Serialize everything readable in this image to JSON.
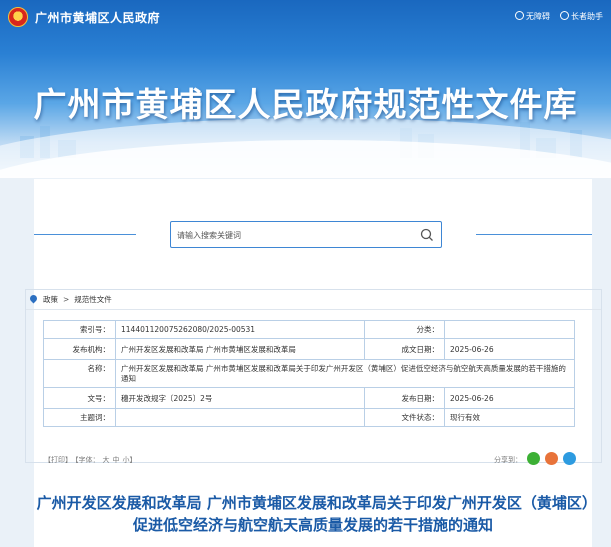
{
  "header": {
    "site_name": "广州市黄埔区人民政府",
    "links": [
      {
        "label": "无障碍",
        "icon": "accessibility-icon"
      },
      {
        "label": "长者助手",
        "icon": "elder-helper-icon"
      }
    ],
    "banner_title": "广州市黄埔区人民政府规范性文件库"
  },
  "search": {
    "placeholder": "请输入搜索关键词"
  },
  "breadcrumb": [
    "政策",
    "规范性文件"
  ],
  "meta": {
    "labels": {
      "index": "索引号：",
      "category": "分类：",
      "issuer": "发布机构：",
      "date_created": "成文日期：",
      "name": "名称：",
      "doc_no": "文号：",
      "date_published": "发布日期：",
      "keywords": "主题词：",
      "status": "文件状态："
    },
    "values": {
      "index": "114401120075262080/2025-00531",
      "category": "",
      "issuer": "广州开发区发展和改革局 广州市黄埔区发展和改革局",
      "date_created": "2025-06-26",
      "name": "广州开发区发展和改革局 广州市黄埔区发展和改革局关于印发广州开发区（黄埔区）促进低空经济与航空航天高质量发展的若干措施的通知",
      "doc_no": "穗开发改规字〔2025〕2号",
      "date_published": "2025-06-26",
      "keywords": "",
      "status": "现行有效"
    }
  },
  "tools": {
    "print": "【打印】",
    "font_label": "【字体：",
    "font_large": "大",
    "font_medium": "中",
    "font_small": "小】",
    "share_label": "分享到："
  },
  "share_colors": {
    "wechat": "#3cb035",
    "weibo": "#e8733a",
    "qq": "#2d9be0"
  },
  "document": {
    "title": "广州开发区发展和改革局 广州市黄埔区发展和改革局关于印发广州开发区（黄埔区）促进低空经济与航空航天高质量发展的若干措施的通知"
  }
}
